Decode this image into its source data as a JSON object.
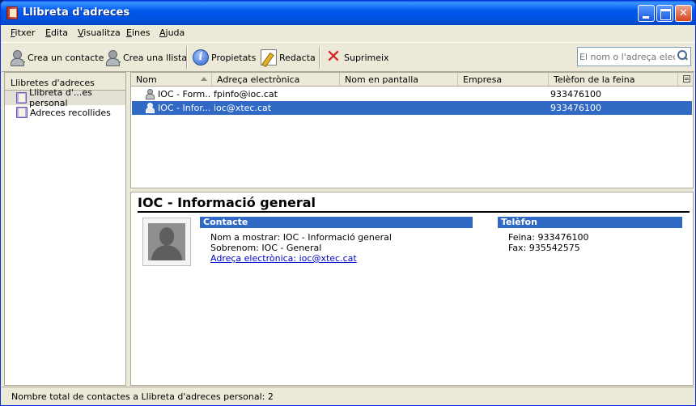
{
  "window": {
    "title": "Llibreta d'adreces"
  },
  "menu": [
    "Fitxer",
    "Edita",
    "Visualitza",
    "Eines",
    "Ajuda"
  ],
  "toolbar": {
    "new_contact": "Crea un contacte",
    "new_list": "Crea una llista",
    "properties": "Propietats",
    "write": "Redacta",
    "delete": "Suprimeix",
    "search_placeholder": "El nom o l'adreça electrò"
  },
  "sidebar": {
    "header": "Llibretes d'adreces",
    "books": [
      {
        "label": "Llibreta d'...es personal",
        "selected": true
      },
      {
        "label": "Adreces recollides",
        "selected": false
      }
    ]
  },
  "list": {
    "columns": [
      "Nom",
      "Adreça electrònica",
      "Nom en pantalla",
      "Empresa",
      "Telèfon de la feina"
    ],
    "rows": [
      {
        "name": "IOC - Form...",
        "email": "fpinfo@ioc.cat",
        "screen_name": "",
        "company": "",
        "work_phone": "933476100",
        "selected": false
      },
      {
        "name": "IOC - Infor...",
        "email": "ioc@xtec.cat",
        "screen_name": "",
        "company": "",
        "work_phone": "933476100",
        "selected": true
      }
    ]
  },
  "detail": {
    "title": "IOC - Informació general",
    "contact_header": "Contacte",
    "phone_header": "Telèfon",
    "display_name": "Nom a mostrar: IOC - Informació general",
    "nickname": "Sobrenom: IOC - General",
    "email_link": "Adreça electrònica: ioc@xtec.cat",
    "work_phone": "Feina: 933476100",
    "fax": "Fax: 935542575"
  },
  "status": {
    "text": "Nombre total de contactes a Llibreta d'adreces personal: 2"
  },
  "colors": {
    "selection": "#316ac5",
    "titlebar": "#0054e3",
    "chrome": "#ece9d8"
  }
}
